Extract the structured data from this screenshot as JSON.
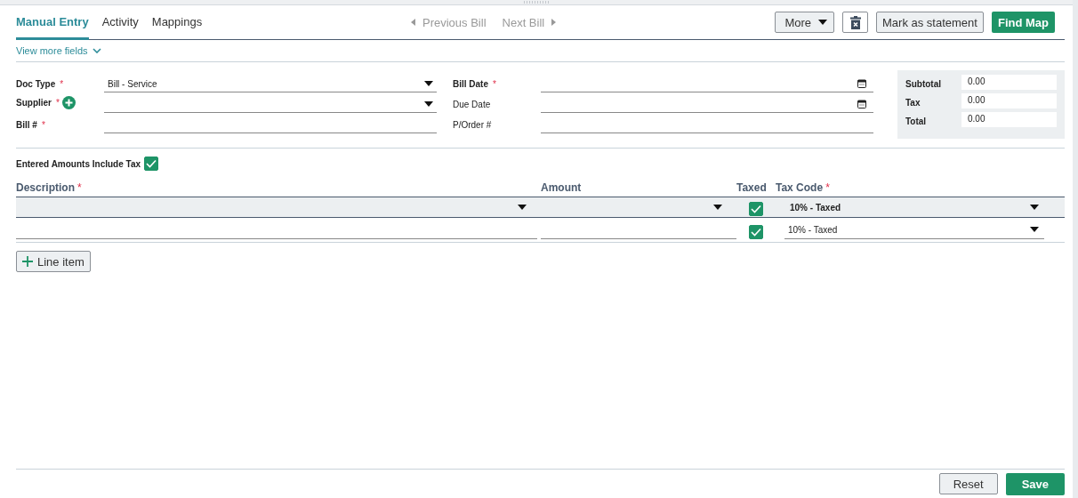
{
  "tabs": [
    {
      "label": "Manual Entry",
      "selected": true
    },
    {
      "label": "Activity",
      "selected": false
    },
    {
      "label": "Mappings",
      "selected": false
    }
  ],
  "pager": {
    "previous": "Previous Bill",
    "next": "Next Bill"
  },
  "toolbar": {
    "more": "More",
    "mark_statement": "Mark as statement",
    "find_map": "Find Map"
  },
  "view_more": "View more fields",
  "left_fields": [
    {
      "label": "Doc Type",
      "required_mark": "*",
      "bold": true,
      "value": "Bill - Service",
      "kind": "dropdown",
      "add": false
    },
    {
      "label": "Supplier",
      "required_mark": "*",
      "bold": true,
      "kind": "dropdown",
      "add": true
    },
    {
      "label": "Bill #",
      "required_mark": "*",
      "bold": true,
      "kind": "text",
      "add": false
    }
  ],
  "right_fields": [
    {
      "label": "Bill Date",
      "required_mark": "*",
      "bold": true,
      "kind": "date"
    },
    {
      "label": "Due Date",
      "bold": false,
      "kind": "date"
    },
    {
      "label": "P/Order #",
      "bold": false,
      "kind": "text"
    }
  ],
  "totals": [
    {
      "label": "Subtotal",
      "value": "0.00"
    },
    {
      "label": "Tax",
      "value": "0.00"
    },
    {
      "label": "Total",
      "value": "0.00"
    }
  ],
  "include_tax": {
    "label": "Entered Amounts Include Tax",
    "checked": true
  },
  "columns": [
    {
      "label": "Description",
      "required_mark": "*"
    },
    {
      "label": "Amount"
    },
    {
      "label": "Taxed"
    },
    {
      "label": "Tax Code",
      "required_mark": "*"
    }
  ],
  "lines": [
    {
      "selected": true,
      "taxed": true,
      "tax_code": "10% - Taxed"
    },
    {
      "selected": false,
      "taxed": true,
      "tax_code": "10% - Taxed"
    }
  ],
  "add_line": "Line item",
  "footer": {
    "reset": "Reset",
    "save": "Save"
  }
}
